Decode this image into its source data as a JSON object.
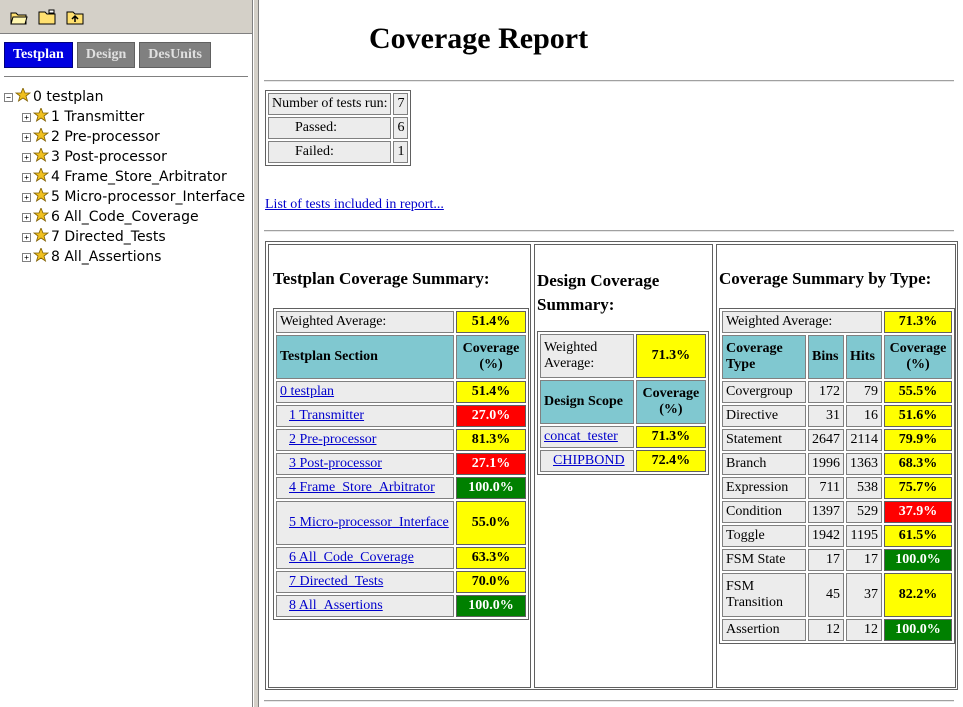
{
  "toolbar": {
    "icons": [
      "open-folder-icon",
      "folder-icon",
      "up-folder-icon"
    ]
  },
  "tabs": [
    {
      "label": "Testplan",
      "active": true
    },
    {
      "label": "Design",
      "active": false
    },
    {
      "label": "DesUnits",
      "active": false
    }
  ],
  "tree": {
    "root": {
      "label": "0 testplan",
      "expander": "−"
    },
    "children": [
      {
        "label": "1 Transmitter",
        "expander": "+"
      },
      {
        "label": "2 Pre-processor",
        "expander": "+"
      },
      {
        "label": "3 Post-processor",
        "expander": "+"
      },
      {
        "label": "4 Frame_Store_Arbitrator",
        "expander": "+"
      },
      {
        "label": "5 Micro-processor_Interface",
        "expander": "+"
      },
      {
        "label": "6 All_Code_Coverage",
        "expander": "+"
      },
      {
        "label": "7 Directed_Tests",
        "expander": "+"
      },
      {
        "label": "8 All_Assertions",
        "expander": "+"
      }
    ]
  },
  "report": {
    "title": "Coverage Report",
    "stats": {
      "tests_run_label": "Number of tests run:",
      "tests_run": "7",
      "passed_label": "Passed:",
      "passed": "6",
      "failed_label": "Failed:",
      "failed": "1"
    },
    "tests_link": "List of tests included in report..."
  },
  "colors": {
    "yellow": "#ffff00",
    "red": "#ff0000",
    "green": "#008000",
    "header_teal": "#80c8d0",
    "tab_active": "#0000e0"
  },
  "testplan_summary": {
    "heading": "Testplan Coverage Summary:",
    "weighted_label": "Weighted Average:",
    "weighted_value": "51.4%",
    "col_section": "Testplan Section",
    "col_coverage": "Coverage (%)",
    "rows": [
      {
        "label": "0 testplan",
        "value": "51.4%",
        "status": "yellow"
      },
      {
        "label": "1 Transmitter",
        "value": "27.0%",
        "status": "red"
      },
      {
        "label": "2 Pre-processor",
        "value": "81.3%",
        "status": "yellow"
      },
      {
        "label": "3 Post-processor",
        "value": "27.1%",
        "status": "red"
      },
      {
        "label": "4 Frame_Store_Arbitrator",
        "value": "100.0%",
        "status": "green"
      },
      {
        "label": "5 Micro-processor_Interface",
        "value": "55.0%",
        "status": "yellow"
      },
      {
        "label": "6 All_Code_Coverage",
        "value": "63.3%",
        "status": "yellow"
      },
      {
        "label": "7 Directed_Tests",
        "value": "70.0%",
        "status": "yellow"
      },
      {
        "label": "8 All_Assertions",
        "value": "100.0%",
        "status": "green"
      }
    ]
  },
  "design_summary": {
    "heading": "Design Coverage Summary:",
    "weighted_label": "Weighted Average:",
    "weighted_value": "71.3%",
    "col_scope": "Design Scope",
    "col_coverage": "Coverage (%)",
    "rows": [
      {
        "label": "concat_tester",
        "value": "71.3%",
        "status": "yellow"
      },
      {
        "label": "CHIPBOND",
        "value": "72.4%",
        "status": "yellow"
      }
    ]
  },
  "type_summary": {
    "heading": "Coverage Summary by Type:",
    "weighted_label": "Weighted Average:",
    "weighted_value": "71.3%",
    "col_type": "Coverage Type",
    "col_bins": "Bins",
    "col_hits": "Hits",
    "col_coverage": "Coverage (%)",
    "rows": [
      {
        "type": "Covergroup",
        "bins": "172",
        "hits": "79",
        "value": "55.5%",
        "status": "yellow"
      },
      {
        "type": "Directive",
        "bins": "31",
        "hits": "16",
        "value": "51.6%",
        "status": "yellow"
      },
      {
        "type": "Statement",
        "bins": "2647",
        "hits": "2114",
        "value": "79.9%",
        "status": "yellow"
      },
      {
        "type": "Branch",
        "bins": "1996",
        "hits": "1363",
        "value": "68.3%",
        "status": "yellow"
      },
      {
        "type": "Expression",
        "bins": "711",
        "hits": "538",
        "value": "75.7%",
        "status": "yellow"
      },
      {
        "type": "Condition",
        "bins": "1397",
        "hits": "529",
        "value": "37.9%",
        "status": "red"
      },
      {
        "type": "Toggle",
        "bins": "1942",
        "hits": "1195",
        "value": "61.5%",
        "status": "yellow"
      },
      {
        "type": "FSM State",
        "bins": "17",
        "hits": "17",
        "value": "100.0%",
        "status": "green"
      },
      {
        "type": "FSM Transition",
        "bins": "45",
        "hits": "37",
        "value": "82.2%",
        "status": "yellow"
      },
      {
        "type": "Assertion",
        "bins": "12",
        "hits": "12",
        "value": "100.0%",
        "status": "green"
      }
    ]
  }
}
